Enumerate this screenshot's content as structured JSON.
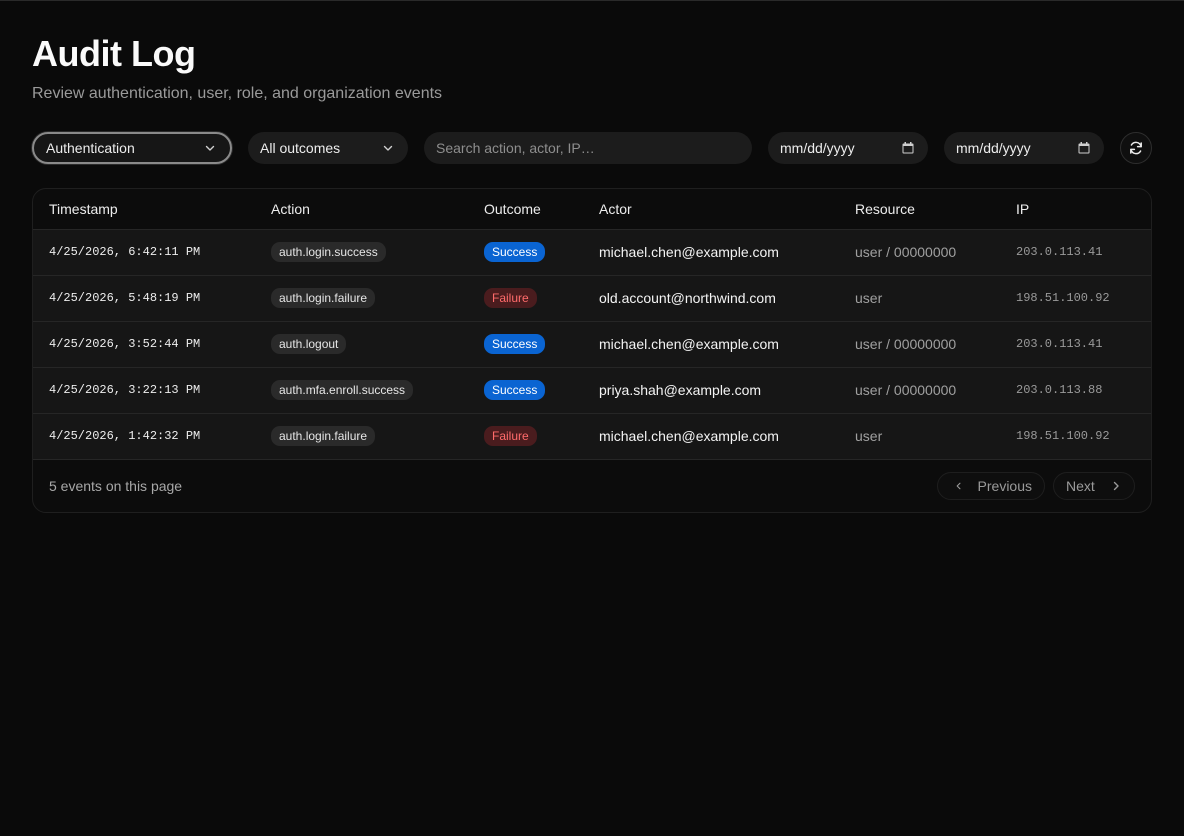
{
  "header": {
    "title": "Audit Log",
    "subtitle": "Review authentication, user, role, and organization events"
  },
  "filters": {
    "category": "Authentication",
    "outcome": "All outcomes",
    "search_placeholder": "Search action, actor, IP…",
    "date_from": "mm/dd/yyyy",
    "date_to": "mm/dd/yyyy",
    "icons": {
      "dropdown": "chevron-down-icon",
      "date": "calendar-icon",
      "refresh": "refresh-icon"
    }
  },
  "table": {
    "columns": [
      "Timestamp",
      "Action",
      "Outcome",
      "Actor",
      "Resource",
      "IP"
    ],
    "rows": [
      {
        "timestamp": "4/25/2026, 6:42:11 PM",
        "action": "auth.login.success",
        "outcome": "Success",
        "actor": "michael.chen@example.com",
        "resource": "user / 00000000",
        "ip": "203.0.113.41"
      },
      {
        "timestamp": "4/25/2026, 5:48:19 PM",
        "action": "auth.login.failure",
        "outcome": "Failure",
        "actor": "old.account@northwind.com",
        "resource": "user",
        "ip": "198.51.100.92"
      },
      {
        "timestamp": "4/25/2026, 3:52:44 PM",
        "action": "auth.logout",
        "outcome": "Success",
        "actor": "michael.chen@example.com",
        "resource": "user / 00000000",
        "ip": "203.0.113.41"
      },
      {
        "timestamp": "4/25/2026, 3:22:13 PM",
        "action": "auth.mfa.enroll.success",
        "outcome": "Success",
        "actor": "priya.shah@example.com",
        "resource": "user / 00000000",
        "ip": "203.0.113.88"
      },
      {
        "timestamp": "4/25/2026, 1:42:32 PM",
        "action": "auth.login.failure",
        "outcome": "Failure",
        "actor": "michael.chen@example.com",
        "resource": "user",
        "ip": "198.51.100.92"
      }
    ]
  },
  "footer": {
    "count_text": "5 events on this page",
    "previous_label": "Previous",
    "next_label": "Next"
  },
  "colors": {
    "background": "#0a0a0a",
    "success": "#0a64d2",
    "failure_bg": "#4a1c1e",
    "failure_text": "#ff6b6b"
  }
}
